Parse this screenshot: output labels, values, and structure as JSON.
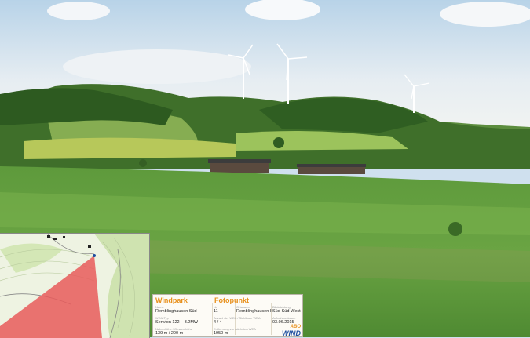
{
  "photo": {
    "subject": "wind turbines",
    "turbine_count": 3
  },
  "info_panel": {
    "col1_title": "Windpark",
    "col2_title": "Fotopunkt",
    "rows": [
      {
        "c1_label": "Name",
        "c1_value": "Remblinghausen Süd",
        "c2_label": "Nr.",
        "c2_value": "11",
        "c3_label": "Ortsname",
        "c3_value": "Remblinghausen II",
        "c4_label": "Blickrichtung",
        "c4_value": "Süd-Süd-West"
      },
      {
        "c1_label": "WEA-Typ",
        "c1_value": "Senvion 122 – 3.2MW",
        "c2_label": "Anzahl der WEA / Sichtbare WEA",
        "c2_value": "4 / 4",
        "c4_label": "Aufnahmedatum",
        "c4_value": "03.06.2015"
      },
      {
        "c1_label": "Nabenhöhe / Gesamthöhe",
        "c1_value": "139 m / 200 m",
        "c2_label": "Entfernung zur nächsten WEA",
        "c2_value": "1950 m"
      }
    ],
    "logo_top": "ABO",
    "logo_bottom": "WIND"
  },
  "colors": {
    "accent": "#e8901c",
    "logo_blue": "#1f4fa0",
    "map_red": "#e85a5a"
  }
}
